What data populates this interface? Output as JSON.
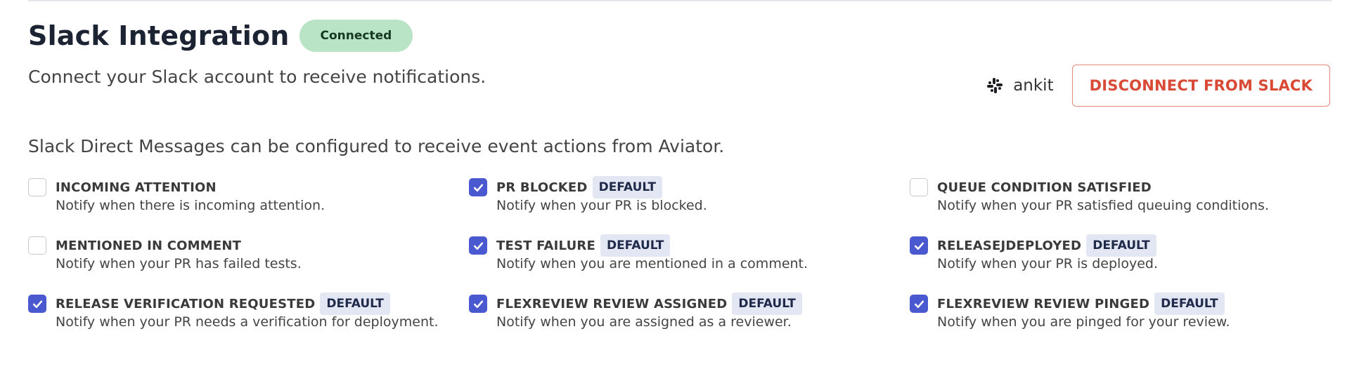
{
  "header": {
    "title": "Slack Integration",
    "status": "Connected",
    "subtitle": "Connect your Slack account to receive notifications."
  },
  "account": {
    "icon": "slack-icon",
    "username": "ankit",
    "disconnect_label": "DISCONNECT FROM SLACK"
  },
  "dm_description": "Slack Direct Messages can be configured to receive event actions from Aviator.",
  "default_label": "DEFAULT",
  "colors": {
    "accent": "#4a59cf",
    "connected_badge": "#b9e4c5",
    "danger": "#d94a36"
  },
  "events": [
    {
      "title": "INCOMING ATTENTION",
      "desc": "Notify when there is incoming attention.",
      "checked": false,
      "is_default": false
    },
    {
      "title": "PR BLOCKED",
      "desc": "Notify when your PR is blocked.",
      "checked": true,
      "is_default": true
    },
    {
      "title": "QUEUE CONDITION SATISFIED",
      "desc": "Notify when your PR satisfied queuing conditions.",
      "checked": false,
      "is_default": false
    },
    {
      "title": "MENTIONED IN COMMENT",
      "desc": "Notify when your PR has failed tests.",
      "checked": false,
      "is_default": false
    },
    {
      "title": "TEST FAILURE",
      "desc": "Notify when you are mentioned in a comment.",
      "checked": true,
      "is_default": true
    },
    {
      "title": "RELEASEJDEPLOYED",
      "desc": "Notify when your PR is deployed.",
      "checked": true,
      "is_default": true
    },
    {
      "title": "RELEASE VERIFICATION REQUESTED",
      "desc": "Notify when your PR needs a verification for deployment.",
      "checked": true,
      "is_default": true
    },
    {
      "title": "FLEXREVIEW REVIEW ASSIGNED",
      "desc": "Notify when you are assigned as a reviewer.",
      "checked": true,
      "is_default": true
    },
    {
      "title": "FLEXREVIEW REVIEW PINGED",
      "desc": "Notify when you are pinged for your review.",
      "checked": true,
      "is_default": true
    }
  ]
}
